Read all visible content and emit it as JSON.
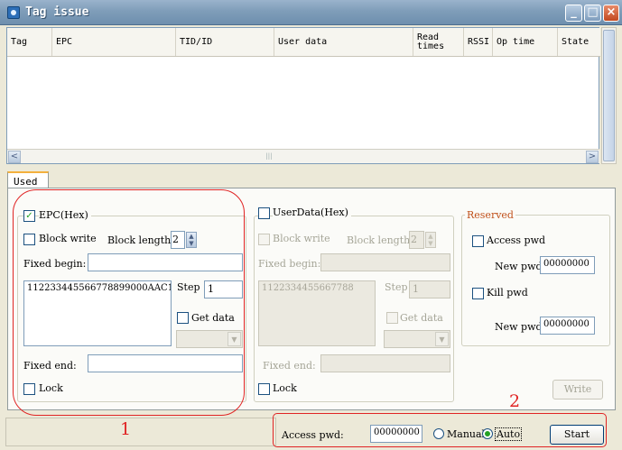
{
  "window": {
    "title": "Tag issue"
  },
  "titlebar_buttons": {
    "minimize": "_",
    "maximize": "□",
    "close": "×"
  },
  "list": {
    "columns": [
      {
        "label": "Tag"
      },
      {
        "label": "EPC"
      },
      {
        "label": "TID/ID"
      },
      {
        "label": "User data"
      },
      {
        "label": "Read times"
      },
      {
        "label": "RSSI"
      },
      {
        "label": "Op time"
      },
      {
        "label": "State"
      }
    ],
    "rows": []
  },
  "scroll": {
    "left": "<",
    "right": ">",
    "grip": "|||"
  },
  "tabs": [
    {
      "label": "Used"
    }
  ],
  "epc": {
    "title": "EPC(Hex)",
    "checked": "✓",
    "block_write": "Block write",
    "block_length_label": "Block length:",
    "block_length_value": "2",
    "fixed_begin_label": "Fixed begin:",
    "fixed_begin_value": "",
    "data_value": "112233445566778899000AAC1",
    "step_label": "Step",
    "step_value": "1",
    "get_data": "Get data",
    "fixed_end_label": "Fixed end:",
    "fixed_end_value": "",
    "lock": "Lock"
  },
  "userdata": {
    "title": "UserData(Hex)",
    "block_write": "Block write",
    "block_length_label": "Block length:",
    "block_length_value": "2",
    "fixed_begin_label": "Fixed begin:",
    "fixed_begin_value": "",
    "data_value": "1122334455667788",
    "step_label": "Step",
    "step_value": "1",
    "get_data": "Get data",
    "fixed_end_label": "Fixed end:",
    "fixed_end_value": "",
    "lock": "Lock"
  },
  "reserved": {
    "title": "Reserved",
    "access_pwd_label": "Access pwd",
    "new_pwd_label_1": "New pwd:",
    "new_pwd_value_1": "00000000",
    "kill_pwd_label": "Kill pwd",
    "new_pwd_label_2": "New pwd:",
    "new_pwd_value_2": "00000000"
  },
  "write_button": "Write",
  "footer": {
    "access_pwd_label": "Access pwd:",
    "access_pwd_value": "00000000",
    "manual": "Manual",
    "auto": "Auto",
    "start": "Start"
  },
  "annotations": {
    "one": "1",
    "two": "2"
  },
  "colors": {
    "annotation": "#e02424",
    "title_bar": "#7f9db9",
    "check": "#21a121"
  }
}
